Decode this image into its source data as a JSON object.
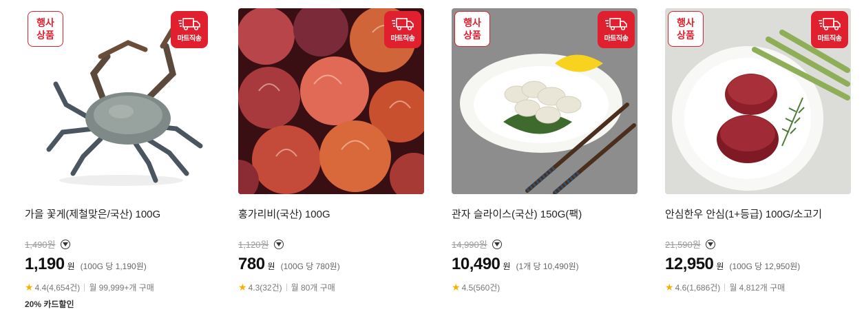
{
  "products": [
    {
      "event_badge": [
        "행사",
        "상품"
      ],
      "mart_badge": "마트직송",
      "image": "blue-crab",
      "name": "가을 꽃게(제철맞은/국산) 100G",
      "original_price": "1,490원",
      "price": "1,190",
      "won": "원",
      "unit_price": "(100G 당 1,190원)",
      "rating": "4.4(4,654건)",
      "purchases": "월 99,999+개 구매",
      "discount": "20% 카드할인"
    },
    {
      "event_badge": null,
      "mart_badge": "마트직송",
      "image": "red-scallops",
      "name": "홍가리비(국산) 100G",
      "original_price": "1,120원",
      "price": "780",
      "won": "원",
      "unit_price": "(100G 당 780원)",
      "rating": "4.3(32건)",
      "purchases": "월 80개 구매",
      "discount": null
    },
    {
      "event_badge": [
        "행사",
        "상품"
      ],
      "mart_badge": "마트직송",
      "image": "sliced-clam-plate",
      "name": "관자 슬라이스(국산) 150G(팩)",
      "original_price": "14,990원",
      "price": "10,490",
      "won": "원",
      "unit_price": "(1개 당 10,490원)",
      "rating": "4.5(560건)",
      "purchases": null,
      "discount": null
    },
    {
      "event_badge": [
        "행사",
        "상품"
      ],
      "mart_badge": "마트직송",
      "image": "beef-tenderloin-plate",
      "name": "안심한우 안심(1+등급) 100G/소고기",
      "original_price": "21,590원",
      "price": "12,950",
      "won": "원",
      "unit_price": "(100G 당 12,950원)",
      "rating": "4.6(1,686건)",
      "purchases": "월 4,812개 구매",
      "discount": null
    }
  ],
  "colors": {
    "accent": "#e0202f",
    "star": "#f5b301"
  }
}
